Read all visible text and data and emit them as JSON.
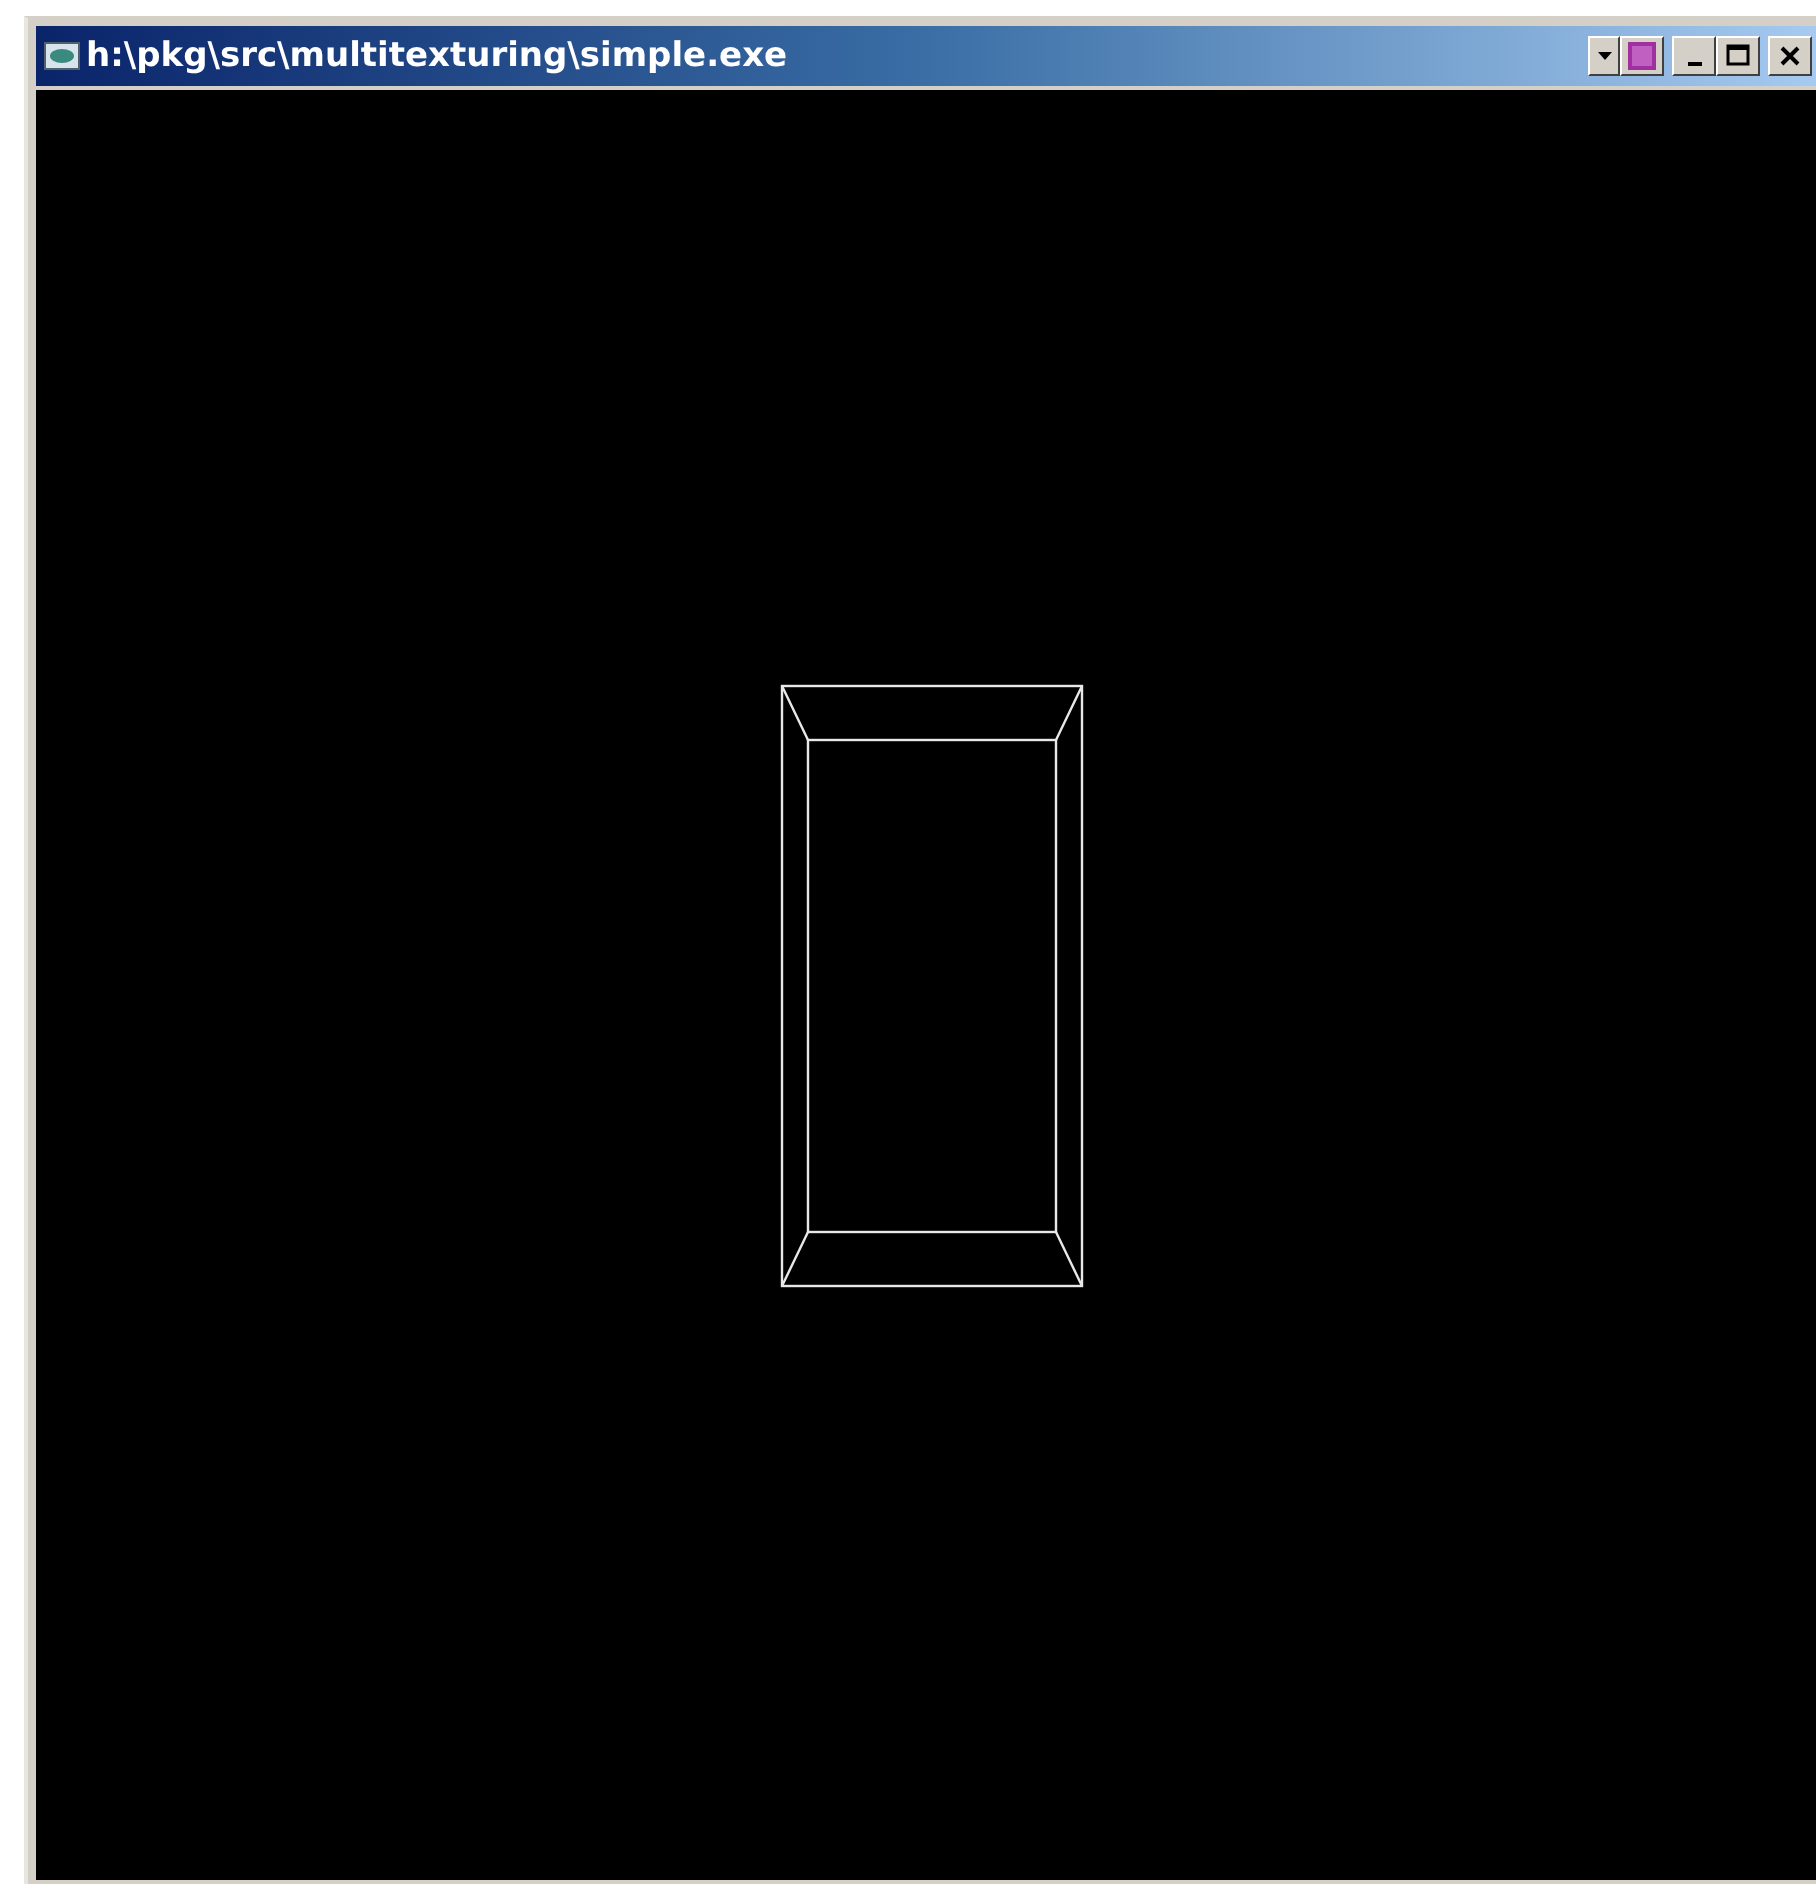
{
  "window": {
    "title": "h:\\pkg\\src\\multitexturing\\simple.exe"
  }
}
